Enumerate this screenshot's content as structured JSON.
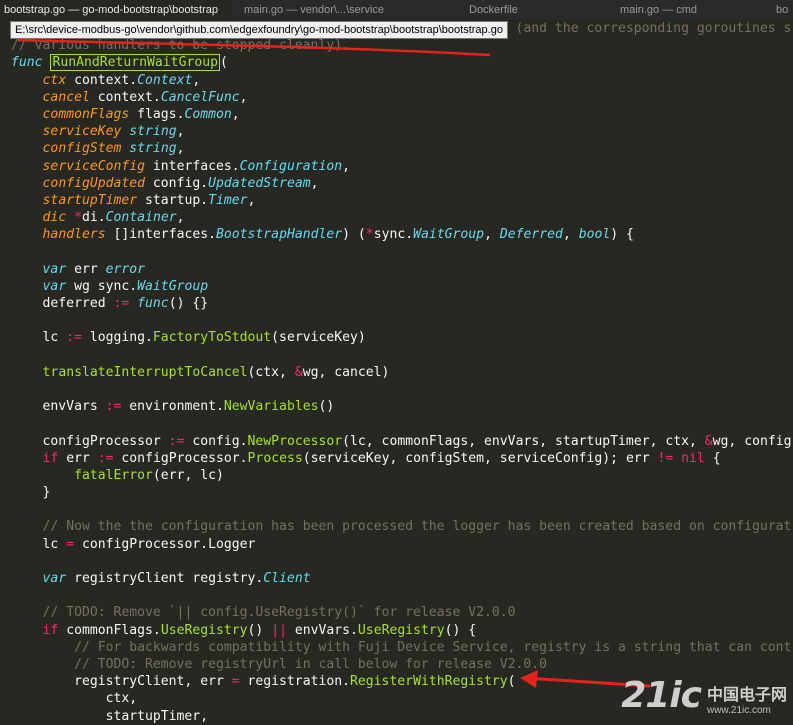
{
  "tabs": [
    {
      "label": "bootstrap.go — go-mod-bootstrap\\bootstrap"
    },
    {
      "label": "main.go — vendor\\...\\service"
    },
    {
      "label": "Dockerfile"
    },
    {
      "label": "main.go — cmd"
    },
    {
      "label": "bo"
    }
  ],
  "tooltip": {
    "path": "E:\\src\\device-modbus-go\\vendor\\github.com\\edgexfoundry\\go-mod-bootstrap\\bootstrap\\bootstrap.go"
  },
  "code_lines": [
    [
      [
        "cm",
        "                                                                (and the corresponding goroutines s"
      ]
    ],
    [
      [
        "cm",
        "// various handlers to be stopped cleanly)."
      ]
    ],
    [
      [
        "kw",
        "func"
      ],
      [
        "p",
        " "
      ],
      [
        "fnbox",
        "RunAndReturnWaitGroup"
      ],
      [
        "p",
        "("
      ]
    ],
    [
      [
        "p",
        "    "
      ],
      [
        "param",
        "ctx"
      ],
      [
        "p",
        " context."
      ],
      [
        "type",
        "Context"
      ],
      [
        "p",
        ","
      ]
    ],
    [
      [
        "p",
        "    "
      ],
      [
        "param",
        "cancel"
      ],
      [
        "p",
        " context."
      ],
      [
        "type",
        "CancelFunc"
      ],
      [
        "p",
        ","
      ]
    ],
    [
      [
        "p",
        "    "
      ],
      [
        "param",
        "commonFlags"
      ],
      [
        "p",
        " flags."
      ],
      [
        "type",
        "Common"
      ],
      [
        "p",
        ","
      ]
    ],
    [
      [
        "p",
        "    "
      ],
      [
        "param",
        "serviceKey"
      ],
      [
        "p",
        " "
      ],
      [
        "type",
        "string"
      ],
      [
        "p",
        ","
      ]
    ],
    [
      [
        "p",
        "    "
      ],
      [
        "param",
        "configStem"
      ],
      [
        "p",
        " "
      ],
      [
        "type",
        "string"
      ],
      [
        "p",
        ","
      ]
    ],
    [
      [
        "p",
        "    "
      ],
      [
        "param",
        "serviceConfig"
      ],
      [
        "p",
        " interfaces."
      ],
      [
        "type",
        "Configuration"
      ],
      [
        "p",
        ","
      ]
    ],
    [
      [
        "p",
        "    "
      ],
      [
        "param",
        "configUpdated"
      ],
      [
        "p",
        " config."
      ],
      [
        "type",
        "UpdatedStream"
      ],
      [
        "p",
        ","
      ]
    ],
    [
      [
        "p",
        "    "
      ],
      [
        "param",
        "startupTimer"
      ],
      [
        "p",
        " startup."
      ],
      [
        "type",
        "Timer"
      ],
      [
        "p",
        ","
      ]
    ],
    [
      [
        "p",
        "    "
      ],
      [
        "param",
        "dic"
      ],
      [
        "p",
        " "
      ],
      [
        "op",
        "*"
      ],
      [
        "p",
        "di."
      ],
      [
        "type",
        "Container"
      ],
      [
        "p",
        ","
      ]
    ],
    [
      [
        "p",
        "    "
      ],
      [
        "param",
        "handlers"
      ],
      [
        "p",
        " []interfaces."
      ],
      [
        "type",
        "BootstrapHandler"
      ],
      [
        "p",
        ") ("
      ],
      [
        "op",
        "*"
      ],
      [
        "p",
        "sync."
      ],
      [
        "type",
        "WaitGroup"
      ],
      [
        "p",
        ", "
      ],
      [
        "type",
        "Deferred"
      ],
      [
        "p",
        ", "
      ],
      [
        "type",
        "bool"
      ],
      [
        "p",
        ") {"
      ]
    ],
    [],
    [
      [
        "p",
        "    "
      ],
      [
        "kw",
        "var"
      ],
      [
        "p",
        " err "
      ],
      [
        "type",
        "error"
      ]
    ],
    [
      [
        "p",
        "    "
      ],
      [
        "kw",
        "var"
      ],
      [
        "p",
        " wg sync."
      ],
      [
        "type",
        "WaitGroup"
      ]
    ],
    [
      [
        "p",
        "    deferred "
      ],
      [
        "op",
        ":="
      ],
      [
        "p",
        " "
      ],
      [
        "kw",
        "func"
      ],
      [
        "p",
        "() {}"
      ]
    ],
    [],
    [
      [
        "p",
        "    lc "
      ],
      [
        "op",
        ":="
      ],
      [
        "p",
        " logging."
      ],
      [
        "fn",
        "FactoryToStdout"
      ],
      [
        "p",
        "(serviceKey)"
      ]
    ],
    [],
    [
      [
        "p",
        "    "
      ],
      [
        "fn",
        "translateInterruptToCancel"
      ],
      [
        "p",
        "(ctx, "
      ],
      [
        "op",
        "&"
      ],
      [
        "p",
        "wg, cancel)"
      ]
    ],
    [],
    [
      [
        "p",
        "    envVars "
      ],
      [
        "op",
        ":="
      ],
      [
        "p",
        " environment."
      ],
      [
        "fn",
        "NewVariables"
      ],
      [
        "p",
        "()"
      ]
    ],
    [],
    [
      [
        "p",
        "    configProcessor "
      ],
      [
        "op",
        ":="
      ],
      [
        "p",
        " config."
      ],
      [
        "fn",
        "NewProcessor"
      ],
      [
        "p",
        "(lc, commonFlags, envVars, startupTimer, ctx, "
      ],
      [
        "op",
        "&"
      ],
      [
        "p",
        "wg, config"
      ]
    ],
    [
      [
        "p",
        "    "
      ],
      [
        "op",
        "if"
      ],
      [
        "p",
        " err "
      ],
      [
        "op",
        ":="
      ],
      [
        "p",
        " configProcessor."
      ],
      [
        "fn",
        "Process"
      ],
      [
        "p",
        "(serviceKey, configStem, serviceConfig); err "
      ],
      [
        "op",
        "!="
      ],
      [
        "p",
        " "
      ],
      [
        "op",
        "nil"
      ],
      [
        "p",
        " {"
      ]
    ],
    [
      [
        "p",
        "        "
      ],
      [
        "fn",
        "fatalError"
      ],
      [
        "p",
        "(err, lc)"
      ]
    ],
    [
      [
        "p",
        "    }"
      ]
    ],
    [],
    [
      [
        "p",
        "    "
      ],
      [
        "cm",
        "// Now the the configuration has been processed the logger has been created based on configurat"
      ]
    ],
    [
      [
        "p",
        "    lc "
      ],
      [
        "op",
        "="
      ],
      [
        "p",
        " configProcessor.Logger"
      ]
    ],
    [],
    [
      [
        "p",
        "    "
      ],
      [
        "kw",
        "var"
      ],
      [
        "p",
        " registryClient registry."
      ],
      [
        "type",
        "Client"
      ]
    ],
    [],
    [
      [
        "p",
        "    "
      ],
      [
        "cm",
        "// TODO: Remove `|| config.UseRegistry()` for release V2.0.0"
      ]
    ],
    [
      [
        "p",
        "    "
      ],
      [
        "op",
        "if"
      ],
      [
        "p",
        " commonFlags."
      ],
      [
        "fn",
        "UseRegistry"
      ],
      [
        "p",
        "() "
      ],
      [
        "op",
        "||"
      ],
      [
        "p",
        " envVars."
      ],
      [
        "fn",
        "UseRegistry"
      ],
      [
        "p",
        "() {"
      ]
    ],
    [
      [
        "p",
        "        "
      ],
      [
        "cm",
        "// For backwards compatibility with Fuji Device Service, registry is a string that can cont"
      ]
    ],
    [
      [
        "p",
        "        "
      ],
      [
        "cm",
        "// TODO: Remove registryUrl in call below for release V2.0.0"
      ]
    ],
    [
      [
        "p",
        "        registryClient, err "
      ],
      [
        "op",
        "="
      ],
      [
        "p",
        " registration."
      ],
      [
        "fn",
        "RegisterWithRegistry"
      ],
      [
        "p",
        "("
      ]
    ],
    [
      [
        "p",
        "            ctx,"
      ]
    ],
    [
      [
        "p",
        "            startupTimer,"
      ]
    ]
  ],
  "watermark": {
    "brand": "21ic",
    "cn": "中国电子网",
    "site": "www.21ic.com"
  },
  "colors": {
    "bg": "#272822",
    "keyword": "#66d9ef",
    "function": "#a6e22e",
    "operator": "#f92672",
    "param": "#fd971f",
    "comment": "#75715e",
    "annotation": "#e5231b"
  }
}
